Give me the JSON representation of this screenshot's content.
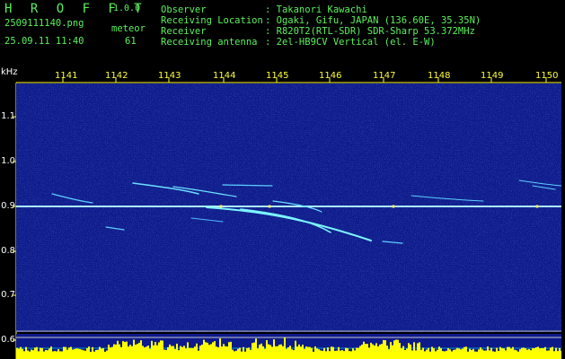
{
  "header": {
    "logo": "H R O F F T",
    "version": "1.0.0",
    "filename": "2509111140.png",
    "timestamp": "25.09.11 11:40",
    "meteor_label": "meteor",
    "meteor_count": "61",
    "info": [
      {
        "label": "Observer",
        "value": ": Takanori Kawachi"
      },
      {
        "label": "Receiving Location",
        "value": ": Ogaki, Gifu, JAPAN (136.60E, 35.35N)"
      },
      {
        "label": "Receiver",
        "value": ": R820T2(RTL-SDR) SDR-Sharp 53.372MHz"
      },
      {
        "label": "Receiving antenna",
        "value": ": 2el-HB9CV Vertical (el. E-W)"
      }
    ]
  },
  "axis": {
    "y_unit": "kHz",
    "y_ticks": [
      "1.1",
      "1.0",
      "0.9",
      "0.8",
      "0.7",
      "0.6"
    ],
    "x_ticks": [
      "1141",
      "1142",
      "1143",
      "1144",
      "1145",
      "1146",
      "1147",
      "1148",
      "1149",
      "1150"
    ]
  },
  "colors": {
    "background": "#000000",
    "spectrogram_bg": "#0d1a8a",
    "text_green": "#5cf05c",
    "tick_yellow": "#ffff33",
    "signal_cyan": "#66e0ff"
  }
}
